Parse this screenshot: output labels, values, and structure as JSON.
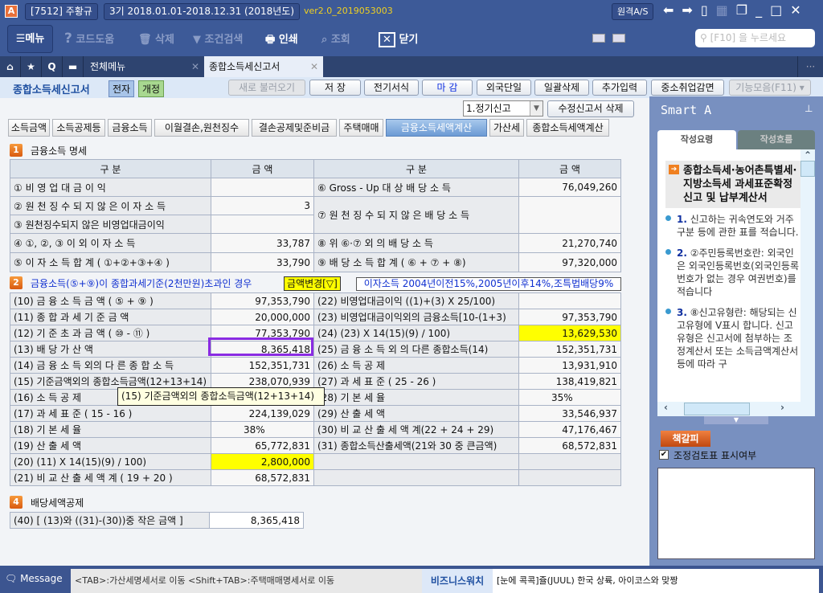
{
  "titlebar": {
    "company": "[7512] 주황규",
    "period": "3기  2018.01.01-2018.12.31  (2018년도)",
    "version": "ver2.0_2019053003",
    "remote_as": "원격A/S"
  },
  "toolbar": {
    "menu": "메뉴",
    "code_help": "코드도움",
    "delete": "삭제",
    "filter": "조건검색",
    "print": "인쇄",
    "view": "조회",
    "close": "닫기",
    "search_placeholder": "[F10] 을 누르세요"
  },
  "tabs": {
    "all_menu": "전체메뉴",
    "active": "종합소득세신고서"
  },
  "subheader": {
    "title": "종합소득세신고서",
    "badge1": "전자",
    "badge2": "개정",
    "buttons": [
      "새로 불러오기",
      "저    장",
      "전기서식",
      "마    감",
      "외국단일",
      "일괄삭제",
      "추가입력",
      "중소취업감면",
      "기능모음(F11)"
    ]
  },
  "filing": {
    "type": "1.정기신고",
    "delete_amend": "수정신고서 삭제"
  },
  "form_tabs": [
    "소득금액",
    "소득공제등",
    "금융소득",
    "이월결손,원천징수",
    "결손공제및준비금",
    "주택매매",
    "금융소득세액계산",
    "가산세",
    "종합소득세액계산"
  ],
  "section1": {
    "no": "1",
    "title": "금융소득 명세",
    "headers": [
      "구      분",
      "금      액",
      "구      분",
      "금      액"
    ],
    "left": [
      [
        "① 비  영  업  대  금  이  익",
        ""
      ],
      [
        "② 원 천 징 수 되 지 않 은 이 자 소 득",
        "3"
      ],
      [
        "③ 원천징수되지 않은 비영업대금이익",
        ""
      ],
      [
        "④ ①, ②, ③  이  외  이  자  소  득",
        "33,787"
      ],
      [
        "⑤ 이 자 소 득 합 계  ( ①+②+③+④ )",
        "33,790"
      ]
    ],
    "right": [
      [
        "⑥ Gross - Up  대  상  배  당  소  득",
        "76,049,260"
      ],
      [
        "⑦ 원 천 징 수 되 지 않 은  배 당 소 득",
        ""
      ],
      [
        "⑧ 위  ⑥·⑦  외  의  배  당  소  득",
        "21,270,740"
      ],
      [
        "⑨ 배 당 소 득  합  계 ( ⑥ + ⑦ + ⑧)",
        "97,320,000"
      ]
    ]
  },
  "section2": {
    "no": "2",
    "title": "금융소득(⑤+⑨)이 종합과세기준(2천만원)초과인 경우",
    "change_button": "금액변경[▽]",
    "rate_note": "이자소득 2004년이전15%,2005년이후14%,조특법배당9%",
    "left": [
      [
        "(10) 금  융  소  득  금  액 ( ⑤ + ⑨ )",
        "97,353,790"
      ],
      [
        "(11) 종  합  과  세  기  준  금  액",
        "20,000,000"
      ],
      [
        "(12) 기  준  초  과  금  액 ( ⑩ - ⑪ )",
        "77,353,790"
      ],
      [
        "(13) 배      당      가      산      액",
        "8,365,418"
      ],
      [
        "(14) 금 융 소 득 외의 다 른 종 합 소 득",
        "152,351,731"
      ],
      [
        "(15) 기준금액외의 종합소득금액(12+13+14)",
        "238,070,939"
      ],
      [
        "(16) 소      득      공      제",
        ""
      ],
      [
        "(17) 과    세    표    준  ( 15 - 16 )",
        "224,139,029"
      ],
      [
        "(18) 기        본        세        율",
        "38%"
      ],
      [
        "(19) 산        출        세        액",
        "65,772,831"
      ],
      [
        "(20)   (11)  X  14(15)(9) / 100)",
        "2,800,000"
      ],
      [
        "(21) 비 교  산 출 세 액  계 ( 19 + 20 )",
        "68,572,831"
      ]
    ],
    "right": [
      [
        "(22) 비영업대금이익 ((1)+(3) X 25/100)",
        ""
      ],
      [
        "(23) 비영업대금이익외의 금융소득[10-(1+3)",
        "97,353,790"
      ],
      [
        "(24)   (23)  X  14(15)(9) / 100)",
        "13,629,530"
      ],
      [
        "(25) 금 융 소 득 외 의 다른 종합소득(14)",
        "152,351,731"
      ],
      [
        "(26) 소        득        공        제",
        "13,931,910"
      ],
      [
        "(27) 과    세    표    준  ( 25  - 26 )",
        "138,419,821"
      ],
      [
        "(28) 기        본        세        율",
        "35%"
      ],
      [
        "(29) 산        출        세        액",
        "33,546,937"
      ],
      [
        "(30) 비 교 산 출 세 액 계(22 + 24 + 29)",
        "47,176,467"
      ],
      [
        "(31) 종합소득산출세액(21와 30 중 큰금액)",
        "68,572,831"
      ],
      [
        "",
        ""
      ],
      [
        "",
        ""
      ]
    ],
    "tooltip": "(15) 기준금액외의 종합소득금액(12+13+14)"
  },
  "section4": {
    "no": "4",
    "title": "배당세액공제",
    "row": [
      "(40) [ (13)와 ((31)-(30))중 작은 금액 ]",
      "8,365,418"
    ]
  },
  "smart": {
    "title": "Smart A",
    "tab1": "작성요령",
    "tab2": "작성흐름",
    "heading": "종합소득세·농어촌특별세·지방소득세 과세표준확정신고 및 납부계산서",
    "items": [
      {
        "no": "1.",
        "text": "신고하는 귀속연도와 거주구분 등에 관한 표를 적습니다."
      },
      {
        "no": "2.",
        "text": "②주민등록번호란: 외국인은 외국인등록번호(외국인등록번호가 없는 경우 여권번호)를 적습니다"
      },
      {
        "no": "3.",
        "text": "⑧신고유형란: 해당되는 신고유형에 V표시 합니다. 신고유형은 신고서에 첨부하는 조정계산서 또는 소득금액계산서 등에 따라 구"
      }
    ],
    "bookmark": "책갈피",
    "checkbox_label": "조정검토표 표시여부",
    "checkbox_checked": true
  },
  "status": {
    "message_label": "Message",
    "message": "<TAB>:가산세명세서로 이동   <Shift+TAB>:주택매매명세서로 이동",
    "biz_label": "비즈니스워치",
    "biz_news": "[눈에 콕콕]쥴(JUUL) 한국 상륙, 아이코스와 맞짱"
  },
  "colors": {
    "accent": "#3d5a98",
    "highlight": "#ffff00",
    "focus": "#8a2be2"
  }
}
